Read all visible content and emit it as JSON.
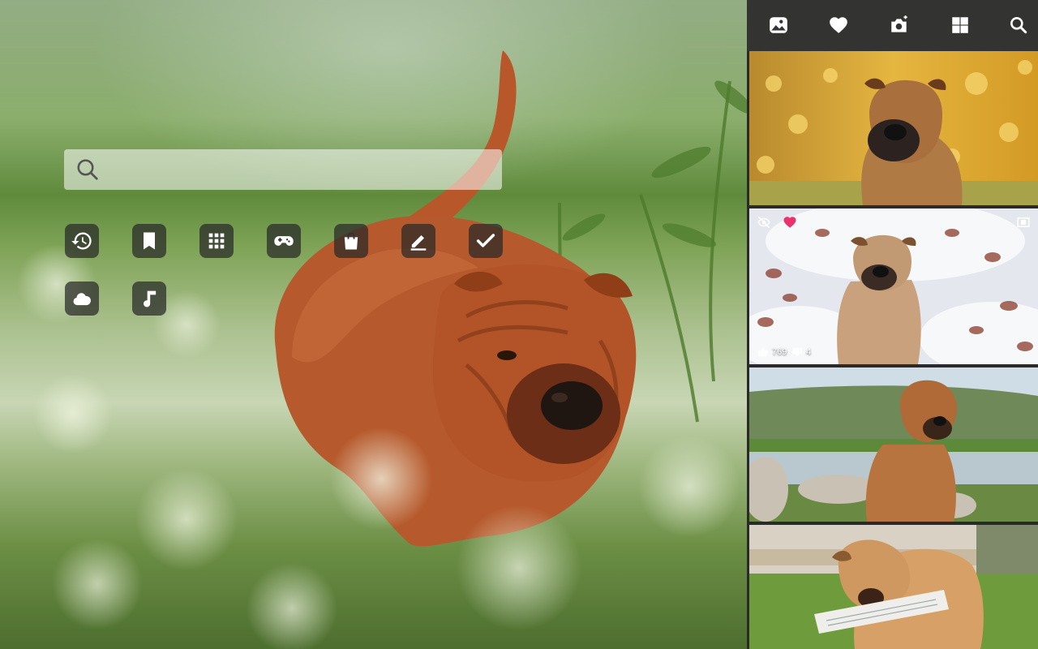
{
  "search": {
    "placeholder": ""
  },
  "shortcuts": [
    {
      "name": "history"
    },
    {
      "name": "bookmarks"
    },
    {
      "name": "apps"
    },
    {
      "name": "games"
    },
    {
      "name": "shopping"
    },
    {
      "name": "notes"
    },
    {
      "name": "tasks"
    },
    {
      "name": "weather"
    },
    {
      "name": "music"
    }
  ],
  "toolbar": [
    {
      "name": "wallpaper-gallery"
    },
    {
      "name": "favorites"
    },
    {
      "name": "add-photo"
    },
    {
      "name": "grid-view"
    },
    {
      "name": "search"
    }
  ],
  "gallery": [
    {
      "name": "shar-pei-autumn"
    },
    {
      "name": "shar-pei-snow",
      "favorited": true,
      "likes": "769",
      "dislikes": "4"
    },
    {
      "name": "shar-pei-lake"
    },
    {
      "name": "shar-pei-puppy-newspaper"
    }
  ],
  "colors": {
    "accent": "#e8336d",
    "sidebar_bg": "#2a2a2a",
    "toolbar_bg": "#333331"
  }
}
